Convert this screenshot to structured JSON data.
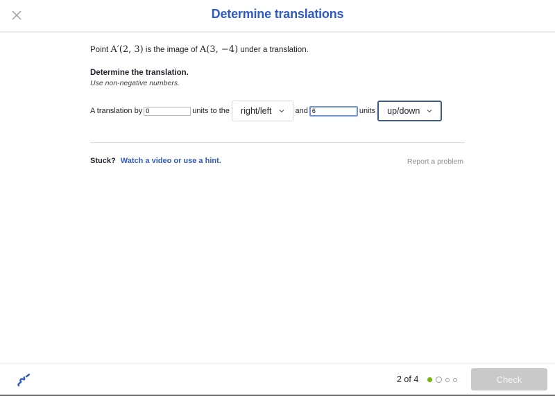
{
  "header": {
    "title": "Determine translations",
    "close_icon": "close-x-icon"
  },
  "question": {
    "prompt_prefix": "Point ",
    "point_image": "A′(2, 3)",
    "prompt_middle": " is the image of ",
    "point_original": "A(3, −4)",
    "prompt_suffix": " under a translation.",
    "instruction_title": "Determine the translation.",
    "instruction_sub": "Use non-negative numbers."
  },
  "answer": {
    "lead_text": "A translation by",
    "horizontal_value": "0",
    "units_to_the": "units to the",
    "horizontal_direction": "right/left",
    "and_text": "and",
    "vertical_value": "6",
    "units_text": "units",
    "vertical_direction": "up/down"
  },
  "help": {
    "stuck_label": "Stuck?",
    "hint_link": "Watch a video or use a hint.",
    "report_link": "Report a problem"
  },
  "footer": {
    "scratchpad_icon": "scratchpad-pencil-icon",
    "progress_text": "2 of 4",
    "progress": {
      "current": 2,
      "total": 4,
      "completed": 1
    },
    "check_label": "Check",
    "colors": {
      "accent": "#2f5bbf",
      "done_dot": "#71b307",
      "check_disabled": "#c9c9c9"
    }
  }
}
